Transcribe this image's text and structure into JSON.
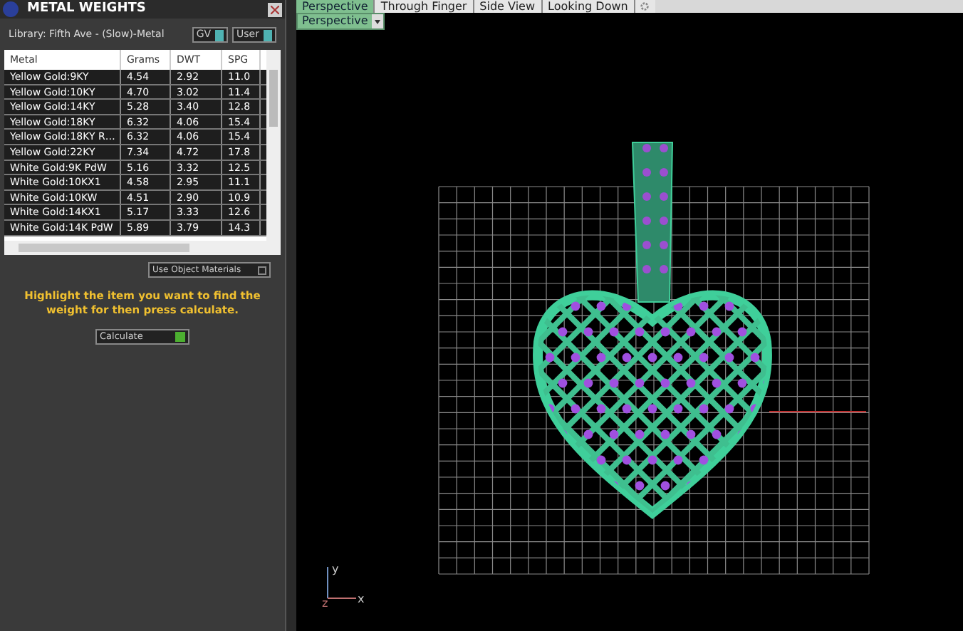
{
  "panel": {
    "title": "METAL WEIGHTS",
    "library": "Library: Fifth Ave - (Slow)-Metal",
    "toggles": [
      {
        "label": "GV",
        "on": true
      },
      {
        "label": "User",
        "on": true
      }
    ]
  },
  "table": {
    "columns": [
      "Metal",
      "Grams",
      "DWT",
      "SPG"
    ],
    "rows": [
      [
        "Yellow Gold:9KY",
        "4.54",
        "2.92",
        "11.0"
      ],
      [
        "Yellow Gold:10KY",
        "4.70",
        "3.02",
        "11.4"
      ],
      [
        "Yellow Gold:14KY",
        "5.28",
        "3.40",
        "12.8"
      ],
      [
        "Yellow Gold:18KY",
        "6.32",
        "4.06",
        "15.4"
      ],
      [
        "Yellow Gold:18KY R…",
        "6.32",
        "4.06",
        "15.4"
      ],
      [
        "Yellow Gold:22KY",
        "7.34",
        "4.72",
        "17.8"
      ],
      [
        "White Gold:9K PdW",
        "5.16",
        "3.32",
        "12.5"
      ],
      [
        "White Gold:10KX1",
        "4.58",
        "2.95",
        "11.1"
      ],
      [
        "White Gold:10KW",
        "4.51",
        "2.90",
        "10.9"
      ],
      [
        "White Gold:14KX1",
        "5.17",
        "3.33",
        "12.6"
      ],
      [
        "White Gold:14K PdW",
        "5.89",
        "3.79",
        "14.3"
      ]
    ]
  },
  "use_object_materials": "Use Object Materials",
  "hint": "Highlight the item you want to find the weight for then press calculate.",
  "calculate_button": "Calculate",
  "viewport": {
    "tabs": [
      {
        "label": "Perspective",
        "selected": true
      },
      {
        "label": "Through Finger",
        "selected": false
      },
      {
        "label": "Side View",
        "selected": false
      },
      {
        "label": "Looking Down",
        "selected": false
      }
    ],
    "view_select": "Perspective",
    "axis_labels": [
      "y",
      "x",
      "z"
    ]
  }
}
